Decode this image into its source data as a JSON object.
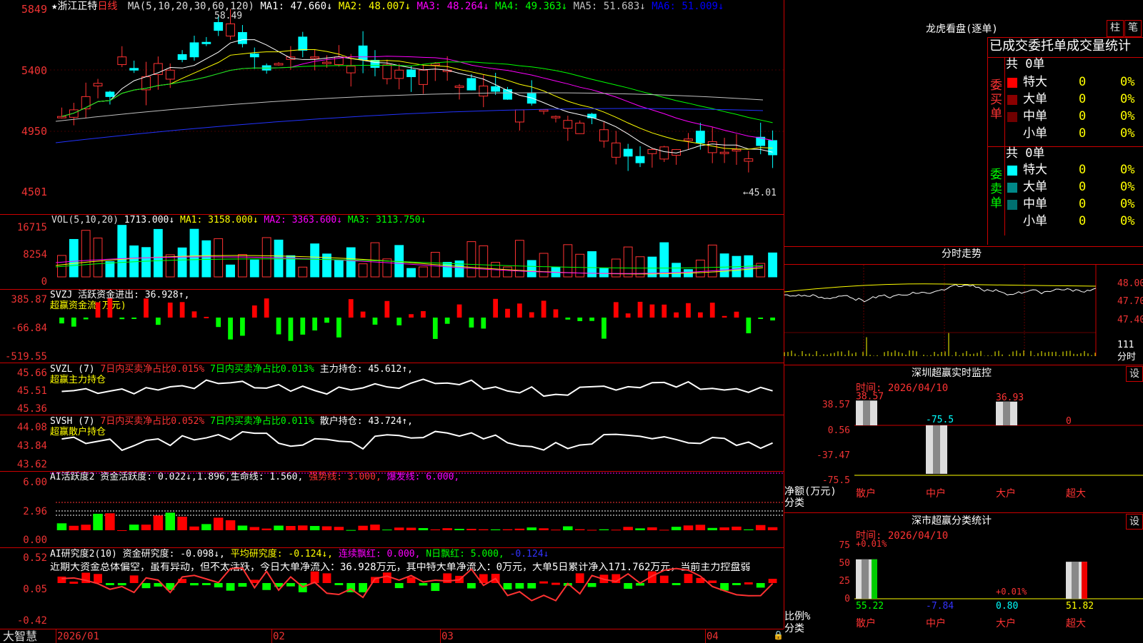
{
  "stock": {
    "star": "★",
    "name": "浙江正特",
    "period": "日线"
  },
  "main": {
    "ma_label": "MA(5,10,20,30,60,120)",
    "ma": [
      {
        "t": "MA1: 47.660↓",
        "c": "#ffffff"
      },
      {
        "t": "MA2: 48.007↓",
        "c": "#ffff00"
      },
      {
        "t": "MA3: 48.264↓",
        "c": "#ff00ff"
      },
      {
        "t": "MA4: 49.363↓",
        "c": "#00ff00"
      },
      {
        "t": "MA5: 51.683↓",
        "c": "#c0c0c0"
      },
      {
        "t": "MA6: 51.009↓",
        "c": "#0000ff"
      }
    ],
    "y_ticks": [
      "5849",
      "5400",
      "4950",
      "4501"
    ],
    "high_mark": "58.49",
    "low_mark": "←45.01"
  },
  "vol": {
    "label": "VOL(5,10,20)",
    "value": "1713.000↓",
    "ma": [
      {
        "t": "MA1: 3158.000↓",
        "c": "#ffff00"
      },
      {
        "t": "MA2: 3363.600↓",
        "c": "#ff00ff"
      },
      {
        "t": "MA3: 3113.750↓",
        "c": "#00ff00"
      }
    ],
    "y_ticks": [
      "16715",
      "8254",
      "0"
    ]
  },
  "svzj": {
    "label": "SVZJ  活跃资金进出: 36.928↑,",
    "sub": "超赢资金流(万元)",
    "y_ticks": [
      "385.87",
      "-66.84",
      "-519.55"
    ]
  },
  "svzl": {
    "label": "SVZL (7)",
    "a": "7日内买卖净占比0.015%",
    "b": "7日内买卖净占比0.013%",
    "c": "主力持仓: 45.612↑,",
    "sub": "超赢主力持仓",
    "y_ticks": [
      "45.66",
      "45.51",
      "45.36"
    ]
  },
  "svsh": {
    "label": "SVSH (7)",
    "a": "7日内买卖净占比0.052%",
    "b": "7日内买卖净占比0.011%",
    "c": "散户持仓: 43.724↑,",
    "sub": "超赢散户持仓",
    "y_ticks": [
      "44.08",
      "43.84",
      "43.62"
    ]
  },
  "ai2": {
    "label": "AI活跃度2 资金活跃度: 0.022↓,1.896,生命线: 1.560,",
    "a": "强势线: 3.000,",
    "b": "爆发线: 6.000,",
    "y_ticks": [
      "6.00",
      "2.96",
      "0.00"
    ]
  },
  "aiy": {
    "label": "AI研究度2(10) 资金研究度: -0.098↓,",
    "a": "平均研究度: -0.124↓,",
    "b": "连续飘红: 0.000,",
    "c": "N日飘红: 5.000,",
    "d": "-0.124↓",
    "text": "近期大资金总体偏空，虽有异动，但不太活跃，今日大单净流入：36.928万元，其中特大单净流入：0万元，大单5日累计净入171.762万元，当前主力控盘弱",
    "y_ticks": [
      "0.52",
      "0.05",
      "-0.42"
    ]
  },
  "xaxis": {
    "brand": "大智慧",
    "labels": [
      "2026/01",
      "02",
      "03",
      "04"
    ]
  },
  "lhb": {
    "title": "龙虎看盘(逐单)",
    "btn1": "柱",
    "btn2": "笔",
    "tabs": "已成交委托单成交量统计",
    "buy": {
      "count": "共 0单",
      "side": "委买单",
      "rows": [
        {
          "n": "特大",
          "v": "0",
          "p": "0%",
          "c": "#ff0000"
        },
        {
          "n": "大单",
          "v": "0",
          "p": "0%",
          "c": "#8b0000"
        },
        {
          "n": "中单",
          "v": "0",
          "p": "0%",
          "c": "#700000"
        },
        {
          "n": "小单",
          "v": "0",
          "p": "0%",
          "c": "#000000"
        }
      ]
    },
    "sell": {
      "count": "共 0单",
      "side": "委卖单",
      "rows": [
        {
          "n": "特大",
          "v": "0",
          "p": "0%",
          "c": "#00ffff"
        },
        {
          "n": "大单",
          "v": "0",
          "p": "0%",
          "c": "#008888"
        },
        {
          "n": "中单",
          "v": "0",
          "p": "0%",
          "c": "#007070"
        },
        {
          "n": "小单",
          "v": "0",
          "p": "0%",
          "c": "#000000"
        }
      ]
    }
  },
  "intraday": {
    "title": "分时走势",
    "y": [
      "48.00",
      "47.70",
      "47.40"
    ],
    "vol": "111",
    "unit": "分时"
  },
  "sz_monitor": {
    "title": "深圳超赢实时监控",
    "set": "设",
    "date": "时间: 2026/04/10",
    "y": [
      "38.57",
      "0.56",
      "-37.47",
      "-75.5"
    ],
    "ylabel": "净额(万元)",
    "xlabel": "分类",
    "bars": [
      {
        "cat": "散户",
        "v": "38.57"
      },
      {
        "cat": "中户",
        "v": "-75.5"
      },
      {
        "cat": "大户",
        "v": "36.93"
      },
      {
        "cat": "超大",
        "v": "0"
      }
    ]
  },
  "sz_class": {
    "title": "深市超赢分类统计",
    "set": "设",
    "date": "时间: 2026/04/10",
    "y": [
      "75",
      "50",
      "25",
      "0"
    ],
    "ylabel": "比例%",
    "xlabel": "分类",
    "bars": [
      {
        "cat": "散户",
        "v": "55.22",
        "top": "+0.01%"
      },
      {
        "cat": "中户",
        "v": "-7.84",
        "top": ""
      },
      {
        "cat": "大户",
        "v": "0.80",
        "top": "+0.01%"
      },
      {
        "cat": "超大",
        "v": "51.82",
        "top": ""
      }
    ]
  },
  "chart_data": {
    "type": "line",
    "title": "浙江正特 日线",
    "note": "price chart; visible markers",
    "high": 58.49,
    "low": 45.01
  }
}
